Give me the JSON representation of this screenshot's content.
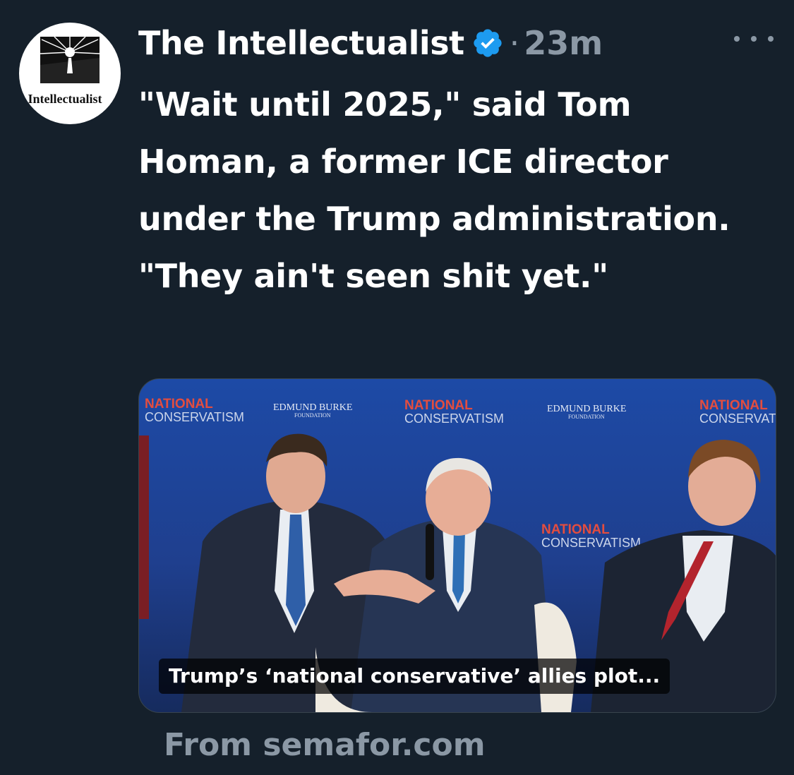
{
  "post": {
    "author": "The Intellectualist",
    "dot": "·",
    "time": "23m",
    "text": "\"Wait until 2025,\" said Tom Homan, a former ICE director under the Trump administration. \"They ain't seen shit yet.\"",
    "avatar_text": "The Intellectualist"
  },
  "card": {
    "caption": "Trump’s ‘national conservative’ allies plot...",
    "backdrop": {
      "national": "NATIONAL",
      "conservatism": "CONSERVATISM",
      "edmund_burke": "EDMUND BURKE",
      "foundation": "FOUNDATION"
    }
  },
  "source": "From semafor.com",
  "colors": {
    "background": "#15202b",
    "secondary_text": "#8b98a5",
    "verified_badge": "#1d9bf0",
    "backdrop_blue": "#1d4aa6"
  },
  "icons": [
    "verified-badge-icon",
    "more-options-icon"
  ]
}
